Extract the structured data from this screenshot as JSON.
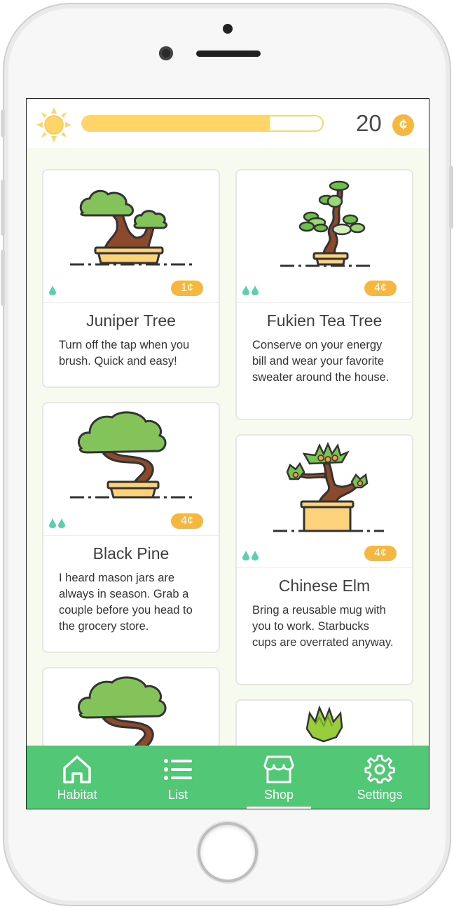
{
  "header": {
    "coins": "20",
    "coin_symbol": "¢",
    "progress_fraction": 0.78,
    "sun_icon": "sun-icon"
  },
  "cards": [
    {
      "name": "Juniper Tree",
      "price": "1¢",
      "drops": 1,
      "desc": "Turn off the tap when you brush. Quick and easy!"
    },
    {
      "name": "Fukien Tea Tree",
      "price": "4¢",
      "drops": 2,
      "desc": "Conserve on your energy bill and wear your favorite sweater around the house."
    },
    {
      "name": "Black Pine",
      "price": "4¢",
      "drops": 2,
      "desc": "I heard mason jars are always in season. Grab a couple before you head to the grocery store."
    },
    {
      "name": "Chinese Elm",
      "price": "4¢",
      "drops": 2,
      "desc": "Bring a reusable mug with you to work. Starbucks cups are overrated anyway."
    }
  ],
  "tabs": [
    {
      "label": "Habitat",
      "icon": "home-icon"
    },
    {
      "label": "List",
      "icon": "list-icon"
    },
    {
      "label": "Shop",
      "icon": "shop-icon",
      "active": true
    },
    {
      "label": "Settings",
      "icon": "gear-icon"
    }
  ],
  "colors": {
    "accent_green": "#52c775",
    "coin_orange": "#f6b740",
    "progress_yellow": "#ffd56a",
    "drop_teal": "#5ccfb0"
  }
}
